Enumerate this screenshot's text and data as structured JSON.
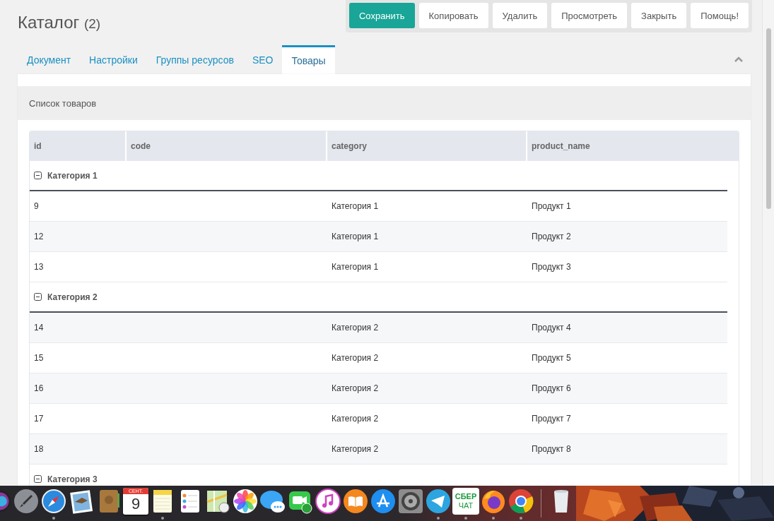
{
  "title": {
    "text": "Каталог",
    "count": "(2)"
  },
  "toolbar": [
    {
      "label": "Сохранить",
      "primary": true
    },
    {
      "label": "Копировать",
      "primary": false
    },
    {
      "label": "Удалить",
      "primary": false
    },
    {
      "label": "Просмотреть",
      "primary": false
    },
    {
      "label": "Закрыть",
      "primary": false
    },
    {
      "label": "Помощь!",
      "primary": false
    }
  ],
  "tabs": [
    {
      "label": "Документ",
      "selected": false
    },
    {
      "label": "Настройки",
      "selected": false
    },
    {
      "label": "Группы ресурсов",
      "selected": false
    },
    {
      "label": "SEO",
      "selected": false
    },
    {
      "label": "Товары",
      "selected": true
    }
  ],
  "panel": {
    "title": "Список товаров"
  },
  "table": {
    "columns": [
      {
        "kind": "text",
        "label": "id"
      },
      {
        "kind": "blank",
        "label": "code"
      },
      {
        "kind": "text",
        "label": "category"
      },
      {
        "kind": "text",
        "label": "product_name"
      }
    ],
    "groups": [
      {
        "label": "Категория 1",
        "expanded": true,
        "rows": [
          [
            "9",
            "Категория 1",
            "Продукт 1"
          ],
          [
            "12",
            "Категория 1",
            "Продукт 2"
          ],
          [
            "13",
            "Категория 1",
            "Продукт 3"
          ]
        ]
      },
      {
        "label": "Категория 2",
        "expanded": true,
        "rows": [
          [
            "14",
            "Категория 2",
            "Продукт 4"
          ],
          [
            "15",
            "Категория 2",
            "Продукт 5"
          ],
          [
            "16",
            "Категория 2",
            "Продукт 6"
          ],
          [
            "17",
            "Категория 2",
            "Продукт 7"
          ],
          [
            "18",
            "Категория 2",
            "Продукт 8"
          ]
        ]
      },
      {
        "label": "Категория 3",
        "expanded": true
      }
    ]
  },
  "dock": {
    "items": [
      {
        "kind": "siri",
        "running": false
      },
      {
        "kind": "launchpad",
        "running": false
      },
      {
        "kind": "safari",
        "running": true
      },
      {
        "kind": "mail",
        "running": false
      },
      {
        "kind": "contacts",
        "running": false
      },
      {
        "kind": "calendar",
        "running": false,
        "month": "СЕНТ.",
        "day": "9"
      },
      {
        "kind": "notes",
        "running": true
      },
      {
        "kind": "reminders",
        "running": false
      },
      {
        "kind": "maps",
        "running": false
      },
      {
        "kind": "photos",
        "running": false
      },
      {
        "kind": "messages",
        "running": false
      },
      {
        "kind": "facetime",
        "running": false
      },
      {
        "kind": "music",
        "running": false
      },
      {
        "kind": "books",
        "running": false
      },
      {
        "kind": "appstore",
        "running": false
      },
      {
        "kind": "settings",
        "running": false
      },
      {
        "kind": "telegram",
        "running": true
      },
      {
        "kind": "sber",
        "running": true,
        "line_1": "СБЕР",
        "line_2": "ЧАТ"
      },
      {
        "kind": "firefox",
        "running": true
      },
      {
        "kind": "chrome",
        "running": true
      },
      {
        "kind": "separator"
      },
      {
        "kind": "trash",
        "running": false
      }
    ]
  }
}
